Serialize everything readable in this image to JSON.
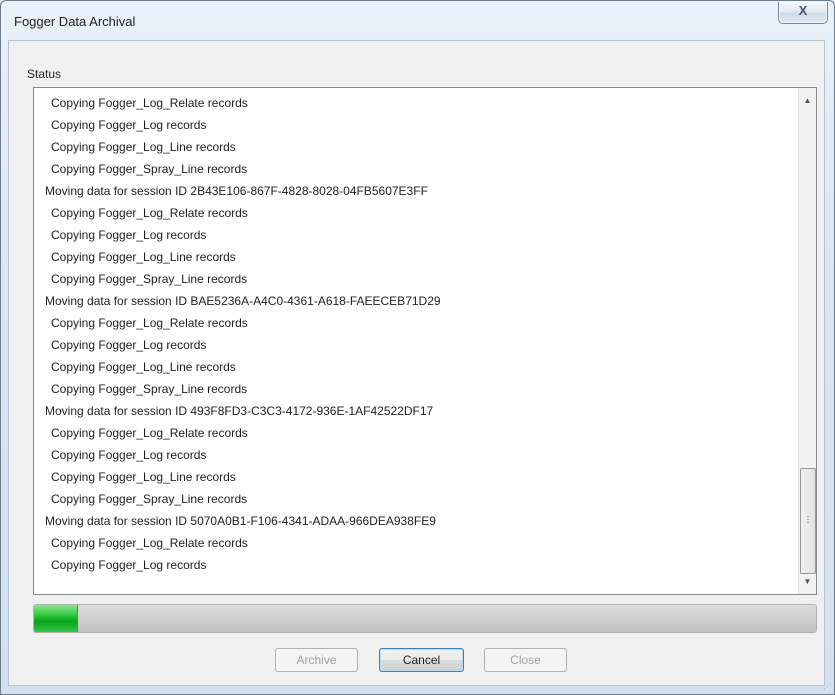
{
  "window": {
    "title": "Fogger Data Archival",
    "close_glyph": "X"
  },
  "status": {
    "label": "Status",
    "lines": [
      {
        "text": "Copying Fogger_Log_Relate records",
        "kind": "indent"
      },
      {
        "text": "Copying Fogger_Log records",
        "kind": "indent"
      },
      {
        "text": "Copying Fogger_Log_Line records",
        "kind": "indent"
      },
      {
        "text": "Copying Fogger_Spray_Line records",
        "kind": "indent"
      },
      {
        "text": "Moving data for session ID 2B43E106-867F-4828-8028-04FB5607E3FF",
        "kind": "session"
      },
      {
        "text": "Copying Fogger_Log_Relate records",
        "kind": "indent"
      },
      {
        "text": "Copying Fogger_Log records",
        "kind": "indent"
      },
      {
        "text": "Copying Fogger_Log_Line records",
        "kind": "indent"
      },
      {
        "text": "Copying Fogger_Spray_Line records",
        "kind": "indent"
      },
      {
        "text": "Moving data for session ID BAE5236A-A4C0-4361-A618-FAEECEB71D29",
        "kind": "session"
      },
      {
        "text": "Copying Fogger_Log_Relate records",
        "kind": "indent"
      },
      {
        "text": "Copying Fogger_Log records",
        "kind": "indent"
      },
      {
        "text": "Copying Fogger_Log_Line records",
        "kind": "indent"
      },
      {
        "text": "Copying Fogger_Spray_Line records",
        "kind": "indent"
      },
      {
        "text": "Moving data for session ID 493F8FD3-C3C3-4172-936E-1AF42522DF17",
        "kind": "session"
      },
      {
        "text": "Copying Fogger_Log_Relate records",
        "kind": "indent"
      },
      {
        "text": "Copying Fogger_Log records",
        "kind": "indent"
      },
      {
        "text": "Copying Fogger_Log_Line records",
        "kind": "indent"
      },
      {
        "text": "Copying Fogger_Spray_Line records",
        "kind": "indent"
      },
      {
        "text": "Moving data for session ID 5070A0B1-F106-4341-ADAA-966DEA938FE9",
        "kind": "session"
      },
      {
        "text": "Copying Fogger_Log_Relate records",
        "kind": "indent"
      },
      {
        "text": "Copying Fogger_Log records",
        "kind": "indent"
      }
    ]
  },
  "scrollbar": {
    "up_icon": "▲",
    "down_icon": "▼",
    "position": 0.78,
    "visible_fraction": 0.22
  },
  "progress": {
    "value": 0.055,
    "fill_color": "#1fb82f"
  },
  "buttons": {
    "archive": {
      "label": "Archive",
      "enabled": false
    },
    "cancel": {
      "label": "Cancel",
      "enabled": true
    },
    "close": {
      "label": "Close",
      "enabled": false
    }
  }
}
